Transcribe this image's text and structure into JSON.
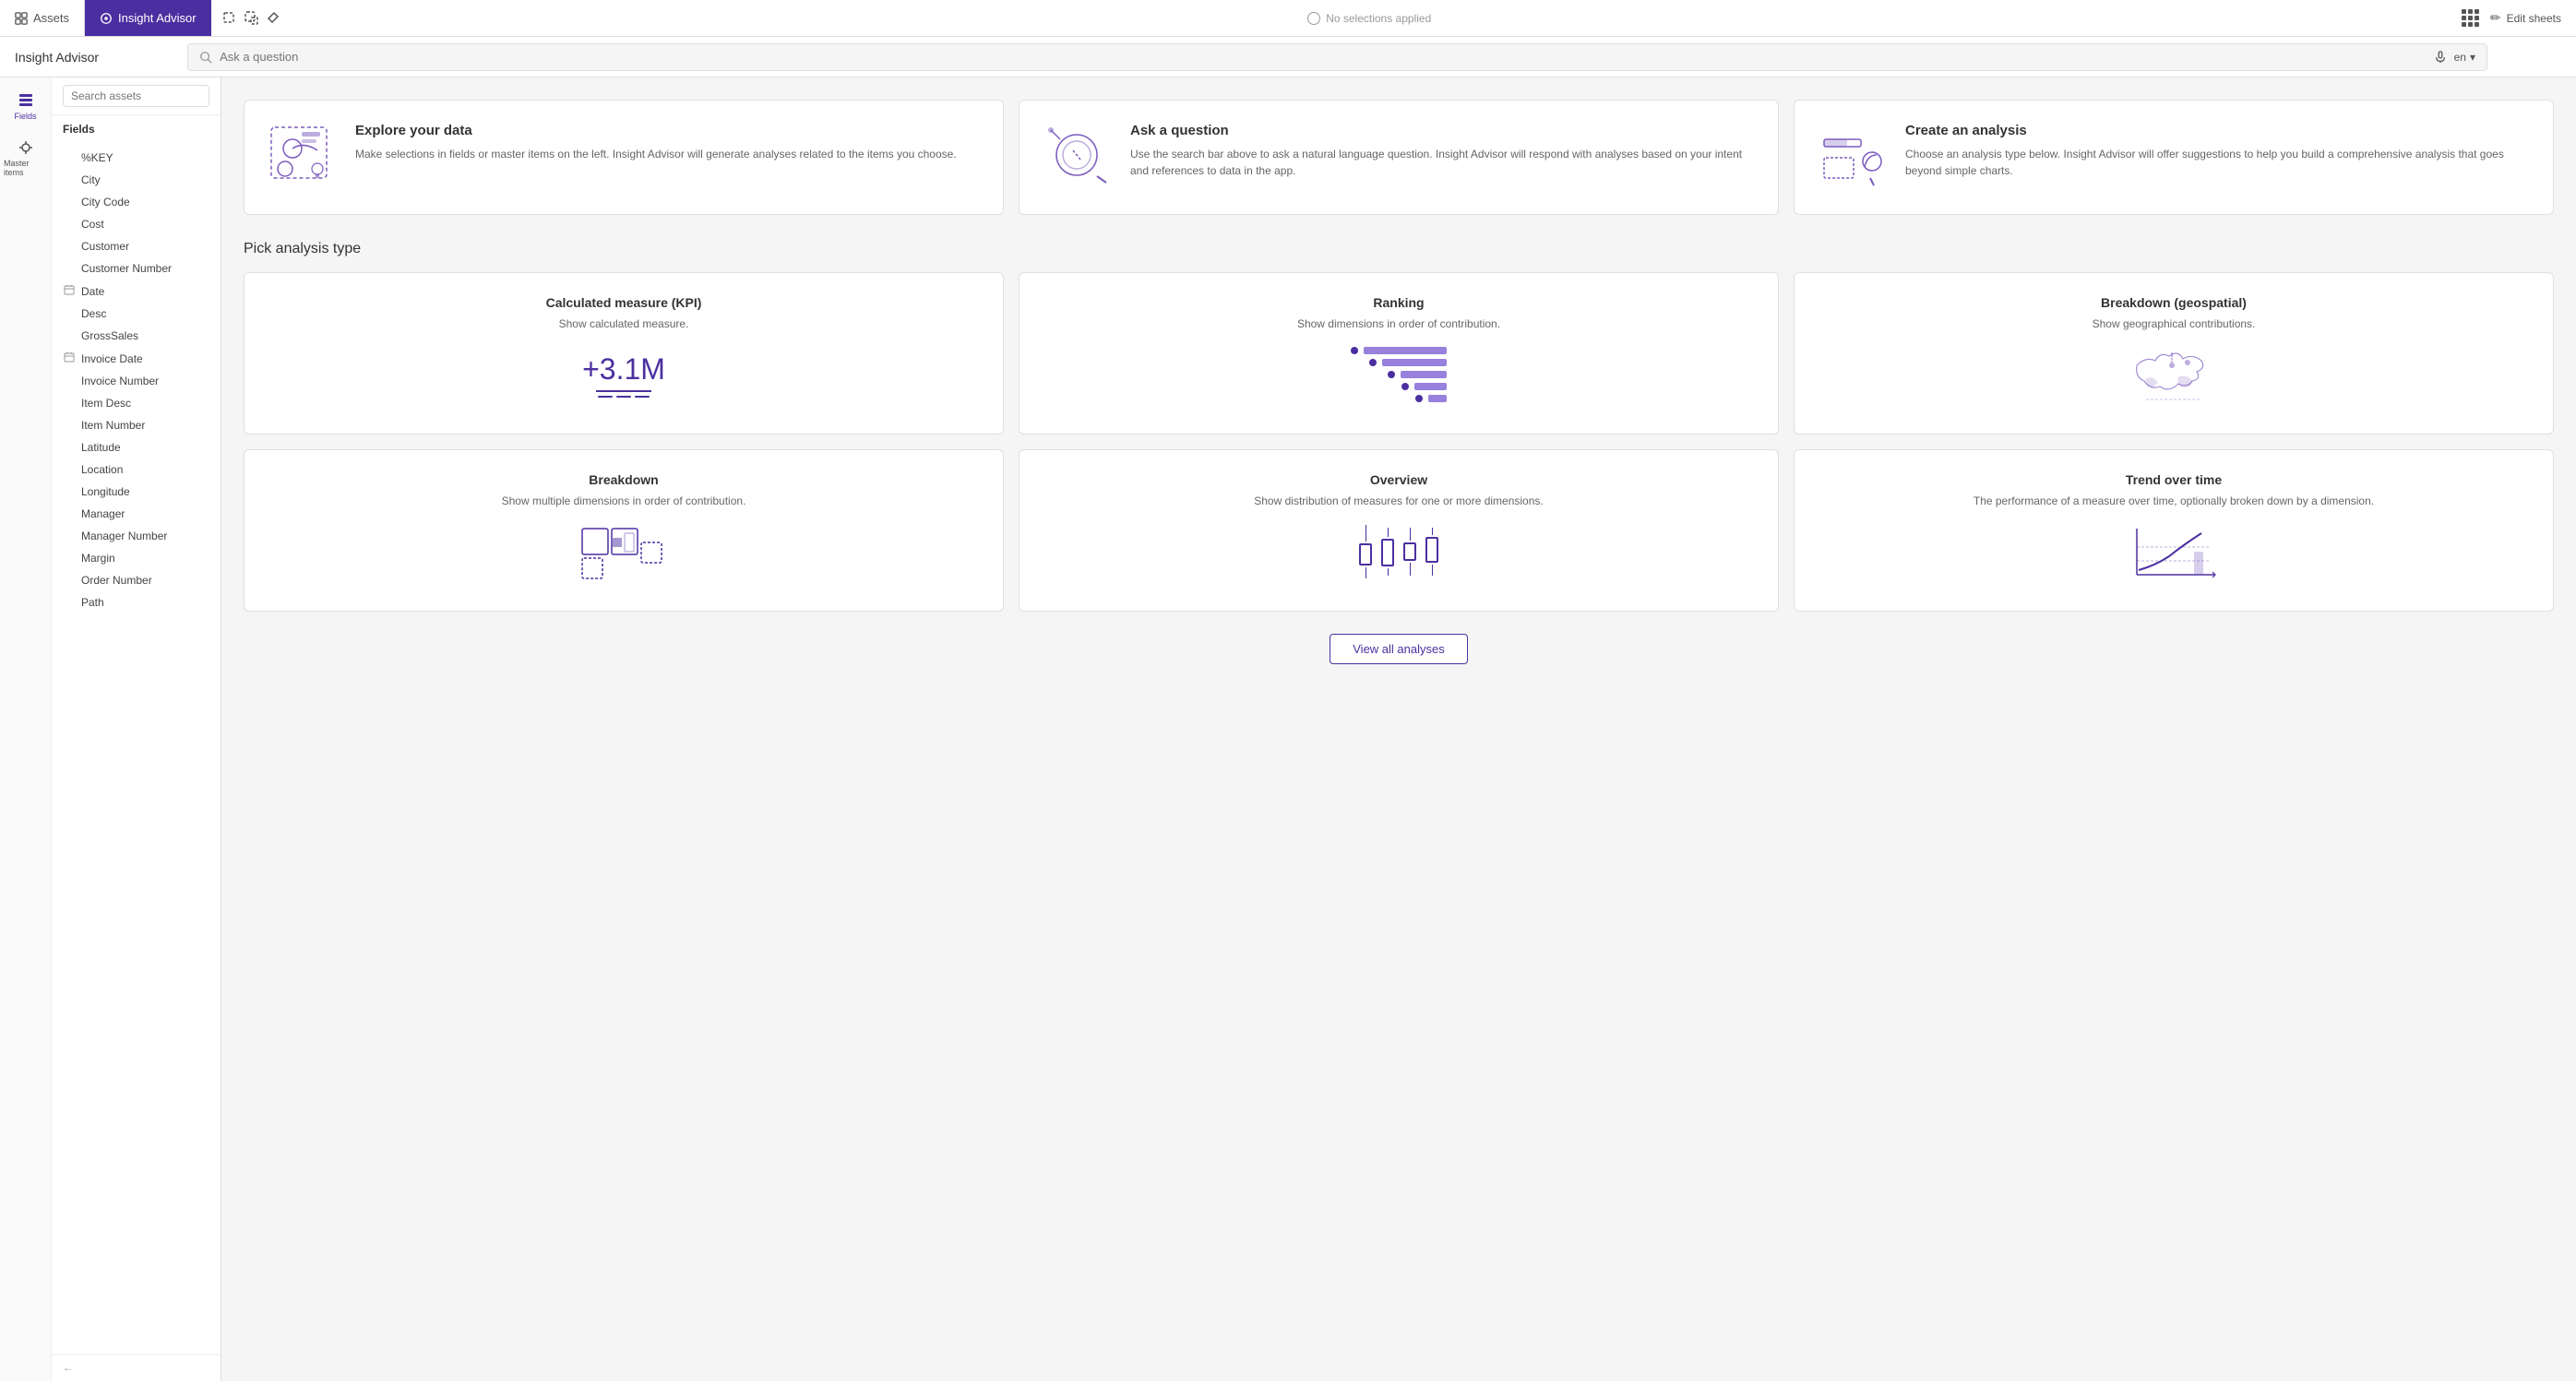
{
  "topNav": {
    "assets_label": "Assets",
    "insight_advisor_label": "Insight Advisor",
    "no_selections": "No selections applied",
    "edit_sheets": "Edit sheets"
  },
  "subNav": {
    "title": "Insight Advisor",
    "search_placeholder": "Ask a question",
    "language": "en"
  },
  "sidebar": {
    "search_placeholder": "Search assets",
    "fields_header": "Fields",
    "fields_label": "Fields",
    "master_items_label": "Master items",
    "fields": [
      {
        "name": "%KEY",
        "icon": ""
      },
      {
        "name": "City",
        "icon": ""
      },
      {
        "name": "City Code",
        "icon": ""
      },
      {
        "name": "Cost",
        "icon": ""
      },
      {
        "name": "Customer",
        "icon": ""
      },
      {
        "name": "Customer Number",
        "icon": ""
      },
      {
        "name": "Date",
        "icon": "calendar"
      },
      {
        "name": "Desc",
        "icon": ""
      },
      {
        "name": "GrossSales",
        "icon": ""
      },
      {
        "name": "Invoice Date",
        "icon": "calendar"
      },
      {
        "name": "Invoice Number",
        "icon": ""
      },
      {
        "name": "Item Desc",
        "icon": ""
      },
      {
        "name": "Item Number",
        "icon": ""
      },
      {
        "name": "Latitude",
        "icon": ""
      },
      {
        "name": "Location",
        "icon": ""
      },
      {
        "name": "Longitude",
        "icon": ""
      },
      {
        "name": "Manager",
        "icon": ""
      },
      {
        "name": "Manager Number",
        "icon": ""
      },
      {
        "name": "Margin",
        "icon": ""
      },
      {
        "name": "Order Number",
        "icon": ""
      },
      {
        "name": "Path",
        "icon": ""
      }
    ]
  },
  "infoCards": [
    {
      "title": "Explore your data",
      "description": "Make selections in fields or master items on the left. Insight Advisor will generate analyses related to the items you choose."
    },
    {
      "title": "Ask a question",
      "description": "Use the search bar above to ask a natural language question. Insight Advisor will respond with analyses based on your intent and references to data in the app."
    },
    {
      "title": "Create an analysis",
      "description": "Choose an analysis type below. Insight Advisor will offer suggestions to help you build a comprehensive analysis that goes beyond simple charts."
    }
  ],
  "analysisSection": {
    "title": "Pick analysis type",
    "types": [
      {
        "name": "Calculated measure (KPI)",
        "description": "Show calculated measure."
      },
      {
        "name": "Ranking",
        "description": "Show dimensions in order of contribution."
      },
      {
        "name": "Breakdown (geospatial)",
        "description": "Show geographical contributions."
      },
      {
        "name": "Breakdown",
        "description": "Show multiple dimensions in order of contribution."
      },
      {
        "name": "Overview",
        "description": "Show distribution of measures for one or more dimensions."
      },
      {
        "name": "Trend over time",
        "description": "The performance of a measure over time, optionally broken down by a dimension."
      }
    ],
    "view_all_label": "View all analyses"
  },
  "kpi": {
    "value": "+3.1M"
  }
}
